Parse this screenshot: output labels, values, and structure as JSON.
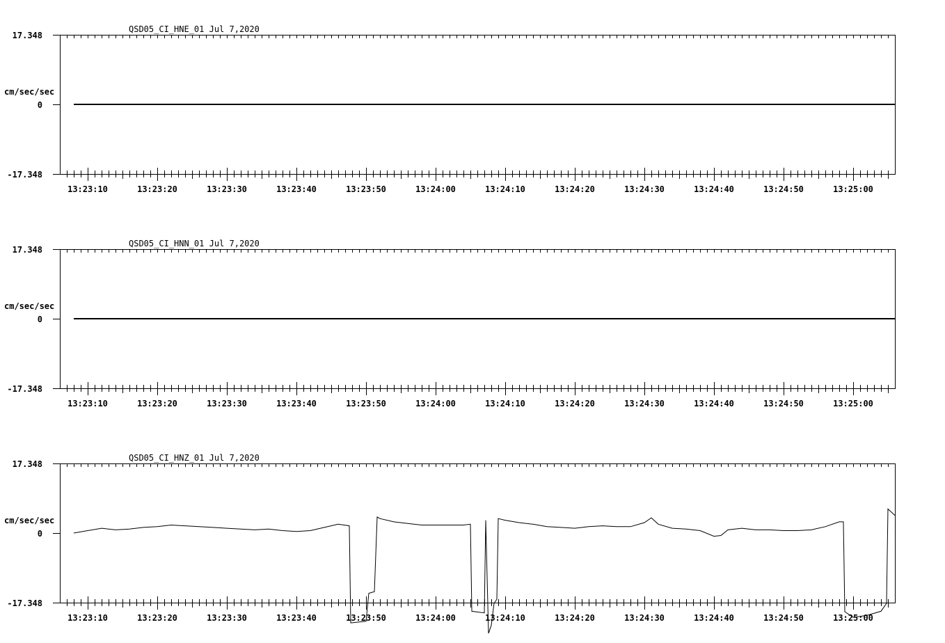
{
  "colors": {
    "background": "#ffffff",
    "ink": "#000000"
  },
  "chart_data": [
    {
      "type": "line",
      "title": "QSD05_CI_HNE_01  Jul 7,2020",
      "ylabel": "cm/sec/sec",
      "ylim": [
        -17.348,
        17.348
      ],
      "ytick_labels": [
        "17.348",
        "0",
        "-17.348"
      ],
      "xlim": [
        "13:23:06",
        "13:25:06"
      ],
      "xtick_labels": [
        "13:23:10",
        "13:23:20",
        "13:23:30",
        "13:23:40",
        "13:23:50",
        "13:24:00",
        "13:24:10",
        "13:24:20",
        "13:24:30",
        "13:24:40",
        "13:24:50",
        "13:25:00"
      ],
      "grid": false,
      "series": [
        {
          "x": [
            "13:23:08",
            "13:25:06"
          ],
          "values": [
            0,
            0
          ]
        }
      ]
    },
    {
      "type": "line",
      "title": "QSD05_CI_HNN_01  Jul 7,2020",
      "ylabel": "cm/sec/sec",
      "ylim": [
        -17.348,
        17.348
      ],
      "ytick_labels": [
        "17.348",
        "0",
        "-17.348"
      ],
      "xlim": [
        "13:23:06",
        "13:25:06"
      ],
      "xtick_labels": [
        "13:23:10",
        "13:23:20",
        "13:23:30",
        "13:23:40",
        "13:23:50",
        "13:24:00",
        "13:24:10",
        "13:24:20",
        "13:24:30",
        "13:24:40",
        "13:24:50",
        "13:25:00"
      ],
      "grid": false,
      "series": [
        {
          "x": [
            "13:23:08",
            "13:25:06"
          ],
          "values": [
            0,
            0
          ]
        }
      ]
    },
    {
      "type": "line",
      "title": "QSD05_CI_HNZ_01  Jul 7,2020",
      "ylabel": "cm/sec/sec",
      "ylim": [
        -17.348,
        17.348
      ],
      "ytick_labels": [
        "17.348",
        "0",
        "-17.348"
      ],
      "xlim": [
        "13:23:06",
        "13:25:06"
      ],
      "xtick_labels": [
        "13:23:10",
        "13:23:20",
        "13:23:30",
        "13:23:40",
        "13:23:50",
        "13:24:00",
        "13:24:10",
        "13:24:20",
        "13:24:30",
        "13:24:40",
        "13:24:50",
        "13:25:00"
      ],
      "grid": false,
      "series": [
        {
          "x": [
            "13:23:08",
            "13:23:10",
            "13:23:12",
            "13:23:14",
            "13:23:16",
            "13:23:18",
            "13:23:20",
            "13:23:22",
            "13:23:24",
            "13:23:26",
            "13:23:28",
            "13:23:30",
            "13:23:32",
            "13:23:34",
            "13:23:36",
            "13:23:38",
            "13:23:40",
            "13:23:42",
            "13:23:44",
            "13:23:46",
            "13:23:47.6",
            "13:23:47.8",
            "13:23:50",
            "13:23:50.4",
            "13:23:51.2",
            "13:23:51.6",
            "13:23:52",
            "13:23:54",
            "13:23:56",
            "13:23:58",
            "13:24:00",
            "13:24:02",
            "13:24:04",
            "13:24:05",
            "13:24:05.2",
            "13:24:07",
            "13:24:07.2",
            "13:24:07.6",
            "13:24:08",
            "13:24:08.4",
            "13:24:08.8",
            "13:24:09",
            "13:24:10",
            "13:24:12",
            "13:24:14",
            "13:24:16",
            "13:24:18",
            "13:24:20",
            "13:24:22",
            "13:24:24",
            "13:24:26",
            "13:24:28",
            "13:24:30",
            "13:24:31",
            "13:24:32",
            "13:24:34",
            "13:24:36",
            "13:24:38",
            "13:24:40",
            "13:24:41",
            "13:24:42",
            "13:24:44",
            "13:24:46",
            "13:24:48",
            "13:24:50",
            "13:24:52",
            "13:24:54",
            "13:24:56",
            "13:24:58",
            "13:24:58.6",
            "13:24:58.8",
            "13:25:00",
            "13:25:02",
            "13:25:04",
            "13:25:04.6",
            "13:25:04.8",
            "13:25:05",
            "13:25:06"
          ],
          "values": [
            0.0,
            0.6,
            1.2,
            0.8,
            1.0,
            1.4,
            1.6,
            2.0,
            1.8,
            1.6,
            1.4,
            1.2,
            1.0,
            0.8,
            1.0,
            0.6,
            0.4,
            0.6,
            1.4,
            2.2,
            1.8,
            -22.4,
            -22.0,
            -15.0,
            -14.6,
            4.0,
            3.6,
            2.8,
            2.4,
            2.0,
            2.0,
            2.0,
            2.0,
            2.2,
            -19.5,
            -19.9,
            3.2,
            -25.0,
            -23.0,
            -17.5,
            -16.5,
            3.6,
            3.2,
            2.6,
            2.2,
            1.6,
            1.4,
            1.2,
            1.6,
            1.8,
            1.6,
            1.6,
            2.6,
            3.8,
            2.2,
            1.2,
            1.0,
            0.6,
            -0.8,
            -0.6,
            0.8,
            1.2,
            0.8,
            0.8,
            0.6,
            0.6,
            0.8,
            1.6,
            2.8,
            2.8,
            -19.6,
            -21.0,
            -20.5,
            -19.5,
            -18.0,
            -17.5,
            6.0,
            4.4
          ]
        }
      ]
    }
  ]
}
